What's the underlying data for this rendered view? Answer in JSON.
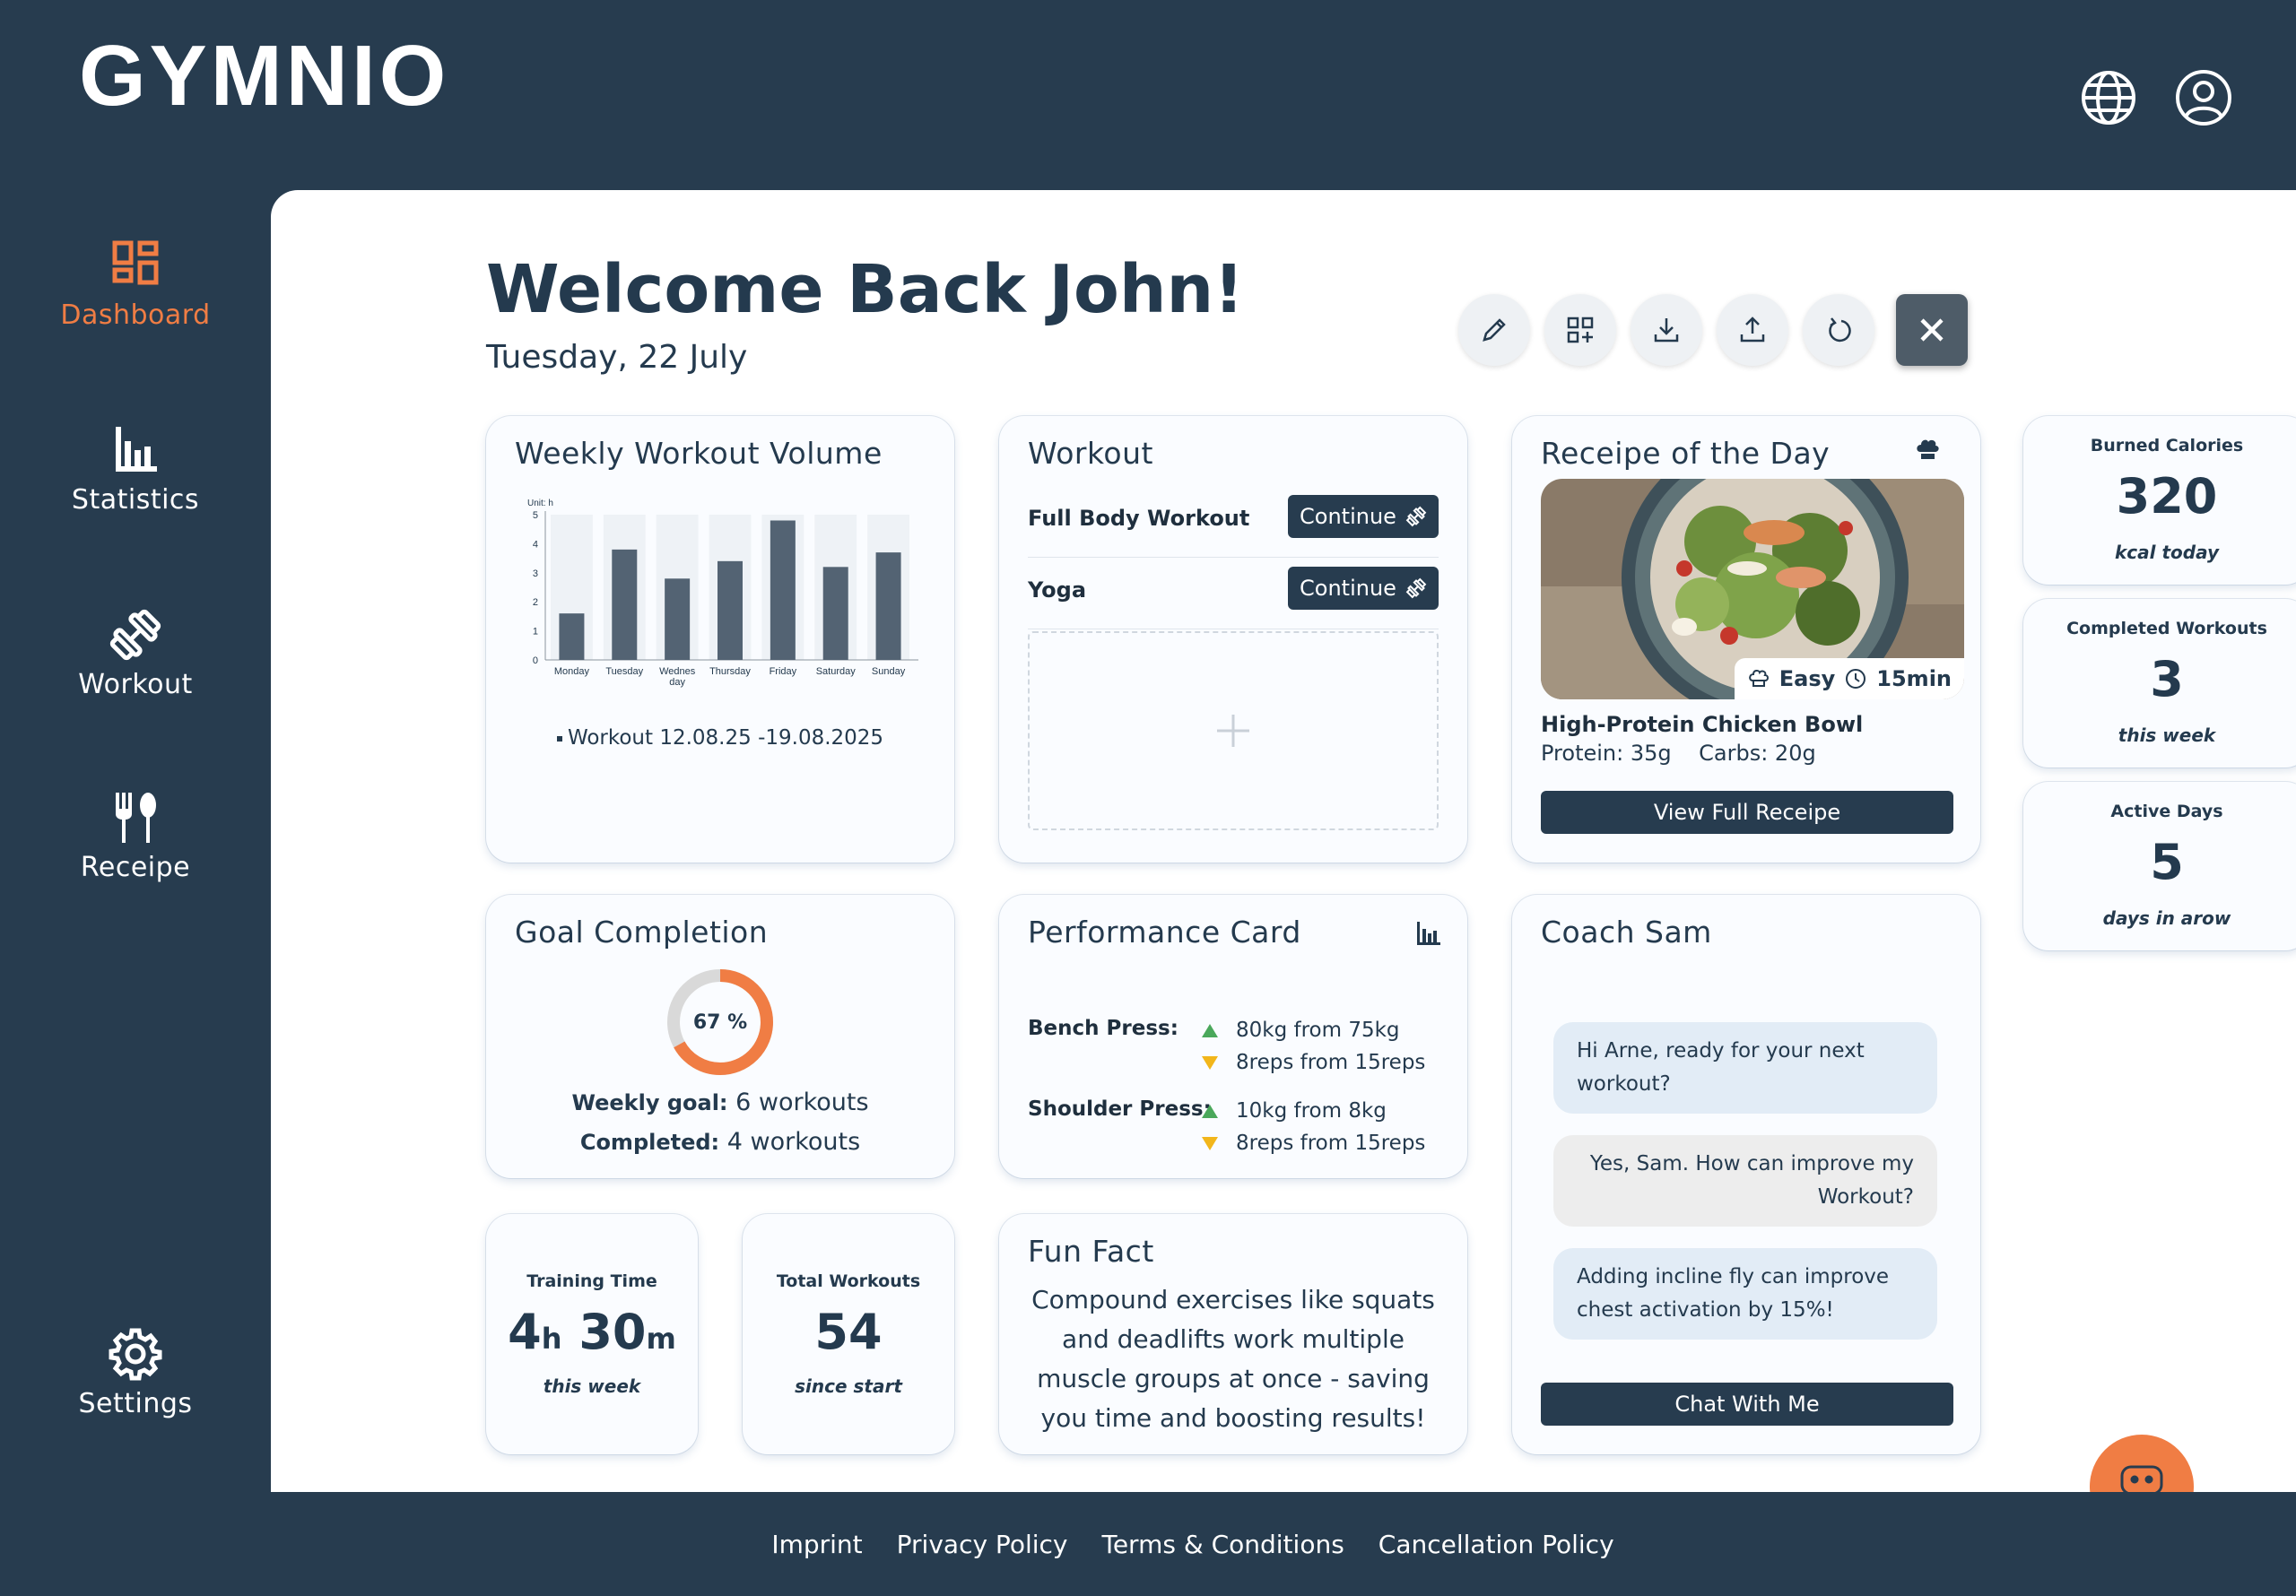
{
  "app": {
    "logo": "GYMNIO"
  },
  "sidebar": {
    "items": [
      {
        "label": "Dashboard",
        "icon": "dashboard-icon",
        "active": true
      },
      {
        "label": "Statistics",
        "icon": "bar-chart-icon"
      },
      {
        "label": "Workout",
        "icon": "dumbbell-icon"
      },
      {
        "label": "Receipe",
        "icon": "fork-spoon-icon"
      }
    ],
    "settings": {
      "label": "Settings",
      "icon": "gear-icon"
    }
  },
  "header": {
    "icons": [
      "globe-icon",
      "user-account-icon"
    ]
  },
  "main": {
    "welcome": "Welcome Back John!",
    "date": "Tuesday, 22 July",
    "toolbar": [
      "edit-icon",
      "add-widget-icon",
      "download-icon",
      "upload-icon",
      "refresh-icon",
      "close-icon"
    ]
  },
  "weekly_volume": {
    "title": "Weekly Workout Volume",
    "unit_label": "Unit: h",
    "legend": "Workout 12.08.25 -19.08.2025"
  },
  "chart_data": {
    "type": "bar",
    "categories": [
      "Monday",
      "Tuesday",
      "Wednesday",
      "Thursday",
      "Friday",
      "Saturday",
      "Sunday"
    ],
    "tick_labels": [
      "Monday",
      "Tuesday",
      "Wednes\nday",
      "Thursday",
      "Friday",
      "Saturday",
      "Sunday"
    ],
    "series": [
      {
        "name": "Workout 12.08.25 -19.08.2025",
        "values": [
          1.6,
          3.8,
          2.8,
          3.4,
          4.8,
          3.2,
          3.7
        ]
      }
    ],
    "ylim": [
      0,
      5
    ],
    "yticks": [
      0,
      1,
      2,
      3,
      4,
      5
    ],
    "ylabel": "Unit: h",
    "xlabel": "",
    "grid": false,
    "legend": "bottom",
    "colors": {
      "bar": "#536373",
      "bg_column": "#eef2f6"
    }
  },
  "workout": {
    "title": "Workout",
    "items": [
      {
        "name": "Full Body Workout",
        "action": "Continue"
      },
      {
        "name": "Yoga",
        "action": "Continue"
      }
    ]
  },
  "recipe": {
    "title": "Receipe of the Day",
    "difficulty": "Easy",
    "duration": "15min",
    "name": "High-Protein Chicken Bowl",
    "protein": "Protein: 35g",
    "carbs": "Carbs: 20g",
    "button": "View Full Receipe"
  },
  "stats": {
    "burned": {
      "label": "Burned Calories",
      "value": "320",
      "sub": "kcal today"
    },
    "completed": {
      "label": "Completed Workouts",
      "value": "3",
      "sub": "this week"
    },
    "active": {
      "label": "Active Days",
      "value": "5",
      "sub": "days in arow"
    }
  },
  "goal": {
    "title": "Goal Completion",
    "percent": 67,
    "percent_label": "67 %",
    "weekly_label": "Weekly goal:",
    "weekly_value": "6 workouts",
    "completed_label": "Completed:",
    "completed_value": "4 workouts"
  },
  "performance": {
    "title": "Performance Card",
    "exercises": [
      {
        "name": "Bench Press:",
        "up": "80kg from 75kg",
        "down": "8reps from 15reps"
      },
      {
        "name": "Shoulder Press:",
        "up": "10kg from 8kg",
        "down": "8reps from 15reps"
      }
    ]
  },
  "coach": {
    "title": "Coach Sam",
    "messages": [
      {
        "from": "coach",
        "text": "Hi Arne, ready for your next workout?"
      },
      {
        "from": "user",
        "text": "Yes, Sam. How can improve my Workout?"
      },
      {
        "from": "coach",
        "text": "Adding incline fly can improve chest activation by 15%!"
      }
    ],
    "button": "Chat With Me"
  },
  "training_time": {
    "label": "Training Time",
    "hours": "4",
    "h": "h",
    "minutes": "30",
    "m": "m",
    "sub": "this week"
  },
  "total_workouts": {
    "label": "Total Workouts",
    "value": "54",
    "sub": "since start"
  },
  "fun_fact": {
    "title": "Fun Fact",
    "text": "Compound exercises like squats and deadlifts work multiple muscle groups at once - saving you time and boosting results!"
  },
  "footer": {
    "links": [
      "Imprint",
      "Privacy Policy",
      "Terms & Conditions",
      "Cancellation Policy"
    ]
  },
  "colors": {
    "accent": "#f07d44",
    "navy": "#273c4f",
    "up": "#4aa85b",
    "down": "#f2b61b"
  }
}
